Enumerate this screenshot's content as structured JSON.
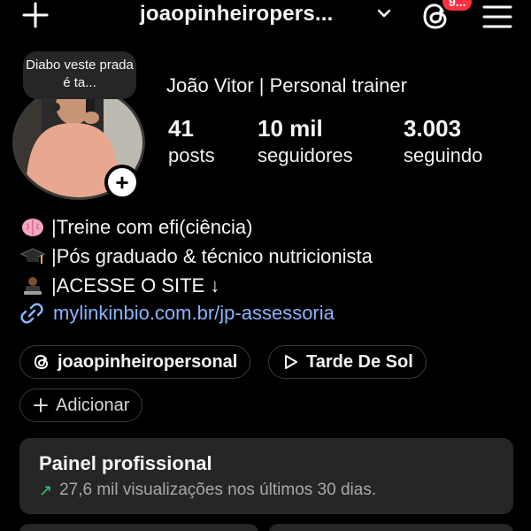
{
  "header": {
    "username": "joaopinheiropers...",
    "badge": "9..."
  },
  "profile": {
    "note": "Diabo veste prada é ta...",
    "display_name": "João Vitor | Personal trainer",
    "stats": {
      "posts_value": "41",
      "posts_label": "posts",
      "followers_value": "10 mil",
      "followers_label": "seguidores",
      "following_value": "3.003",
      "following_label": "seguindo"
    },
    "bio": {
      "line1": "|Treine com efi(ciência)",
      "line2": "|Pós graduado & técnico nutricionista",
      "line3": "|ACESSE O SITE ↓"
    },
    "link": "mylinkinbio.com.br/jp-assessoria"
  },
  "chips": {
    "threads": "joaopinheiropersonal",
    "music": "Tarde De Sol",
    "add": "Adicionar"
  },
  "dashboard": {
    "title": "Painel profissional",
    "subtitle": "27,6 mil visualizações nos últimos 30 dias."
  },
  "colors": {
    "background": "#000000",
    "card": "#262626",
    "link": "#8ab4ff",
    "badge": "#ff3040",
    "trend": "#2ecc71"
  },
  "icons": {
    "bio1": "brain-icon",
    "bio2": "graduation-cap-icon",
    "bio3": "technologist-icon"
  }
}
